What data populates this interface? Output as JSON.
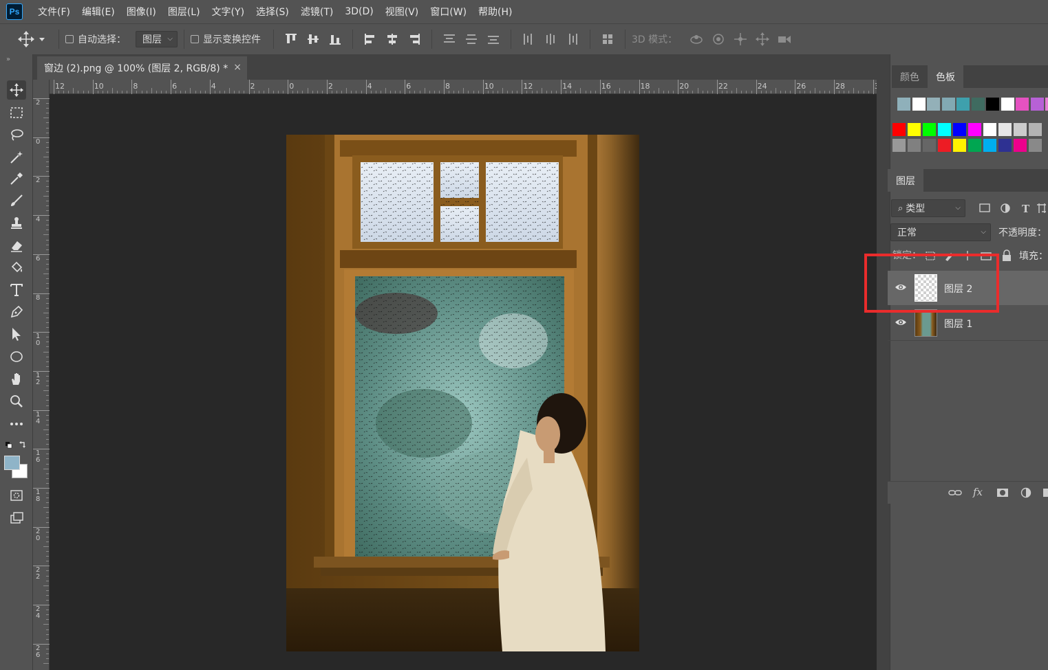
{
  "app": {
    "logo": "Ps"
  },
  "menu": [
    "文件(F)",
    "编辑(E)",
    "图像(I)",
    "图层(L)",
    "文字(Y)",
    "选择(S)",
    "滤镜(T)",
    "3D(D)",
    "视图(V)",
    "窗口(W)",
    "帮助(H)"
  ],
  "options_bar": {
    "auto_select_label": "自动选择：",
    "auto_select_checked": false,
    "auto_select_target": "图层",
    "show_transform_label": "显示变换控件",
    "show_transform_checked": false,
    "mode_3d_label": "3D 模式："
  },
  "document_tab": {
    "title": "窗边 (2).png @ 100% (图层 2, RGB/8) *",
    "close_glyph": "×"
  },
  "ruler_h_labels": [
    "12",
    "10",
    "8",
    "6",
    "4",
    "2",
    "0",
    "2",
    "4",
    "6",
    "8",
    "10",
    "12",
    "14",
    "16",
    "18",
    "20",
    "22",
    "24",
    "26",
    "28",
    "3"
  ],
  "ruler_v_labels": [
    "2",
    "0",
    "2",
    "4",
    "6",
    "8",
    "10",
    "12",
    "14",
    "16",
    "18",
    "20",
    "22",
    "24",
    "26"
  ],
  "tools": [
    "move-tool",
    "marquee-tool",
    "lasso-tool",
    "magic-wand-tool",
    "eyedropper-tool",
    "brush-tool",
    "stamp-tool",
    "eraser-tool",
    "bucket-tool",
    "type-tool",
    "pen-tool",
    "path-select-tool",
    "ellipse-tool",
    "hand-tool",
    "zoom-tool",
    "more-tools",
    "color-swap",
    "foreground-background",
    "quick-mask",
    "screen-mode"
  ],
  "colors": {
    "foreground": "#8fb4c8",
    "background": "#ffffff",
    "highlight": "#ea2c2c"
  },
  "color_panel": {
    "tabs": [
      "颜色",
      "色板"
    ],
    "active_tab": "色板",
    "recent_swatches": [
      "#8fb0ba",
      "#ffffff",
      "#93b0b8",
      "#82a9b3",
      "#3ea0ad",
      "#3f6b60",
      "#000000",
      "#ffffff",
      "#e552c1",
      "#b761d6",
      "#e57fd2"
    ],
    "swatches_row1": [
      "#ff0000",
      "#ffff00",
      "#00ff00",
      "#00ffff",
      "#0000ff",
      "#ff00ff",
      "#ffffff",
      "#e6e6e6",
      "#cccccc",
      "#b3b3b3"
    ],
    "swatches_row2": [
      "#999999",
      "#808080",
      "#666666",
      "#ed1c24",
      "#fff200",
      "#00a651",
      "#00aeef",
      "#2e3192",
      "#ec008c",
      "#898989"
    ]
  },
  "layers_panel": {
    "tab": "图层",
    "filter_label": "类型",
    "blend_mode": "正常",
    "opacity_label": "不透明度：",
    "lock_label": "锁定：",
    "fill_label": "填充：",
    "layers": [
      {
        "name": "图层 2",
        "visible": true,
        "selected": true
      },
      {
        "name": "图层 1",
        "visible": true,
        "selected": false
      }
    ],
    "footer_icons": [
      "link-icon",
      "fx-icon",
      "mask-icon",
      "adjustment-icon",
      "new-layer-icon"
    ],
    "fx_label": "fx"
  }
}
